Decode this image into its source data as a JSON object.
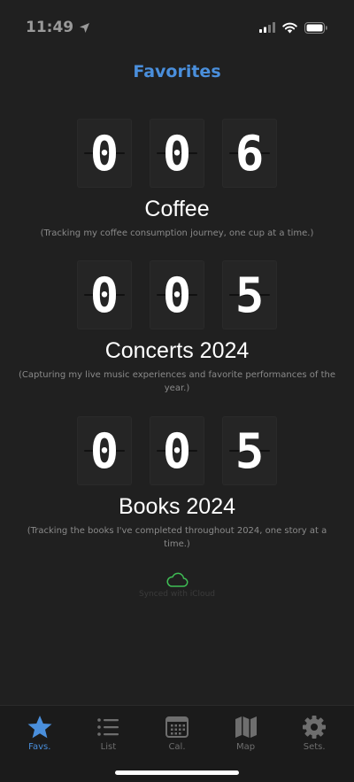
{
  "status": {
    "time": "11:49"
  },
  "header": {
    "title": "Favorites"
  },
  "counters": [
    {
      "digits": [
        "0",
        "0",
        "6"
      ],
      "title": "Coffee",
      "description": "(Tracking my coffee consumption journey, one cup at a time.)"
    },
    {
      "digits": [
        "0",
        "0",
        "5"
      ],
      "title": "Concerts 2024",
      "description": "(Capturing my live music experiences and favorite performances of the year.)"
    },
    {
      "digits": [
        "0",
        "0",
        "5"
      ],
      "title": "Books 2024",
      "description": "(Tracking the books I've completed throughout 2024, one story at a time.)"
    }
  ],
  "sync": {
    "label": "Synced with iCloud",
    "icon": "cloud-icon",
    "color": "#3fbf55"
  },
  "tabs": [
    {
      "label": "Favs.",
      "icon": "star-icon",
      "active": true
    },
    {
      "label": "List",
      "icon": "list-icon",
      "active": false
    },
    {
      "label": "Cal.",
      "icon": "calendar-icon",
      "active": false
    },
    {
      "label": "Map",
      "icon": "map-icon",
      "active": false
    },
    {
      "label": "Sets.",
      "icon": "gear-icon",
      "active": false
    }
  ],
  "colors": {
    "accent": "#4a8fdc",
    "background": "#202020"
  }
}
